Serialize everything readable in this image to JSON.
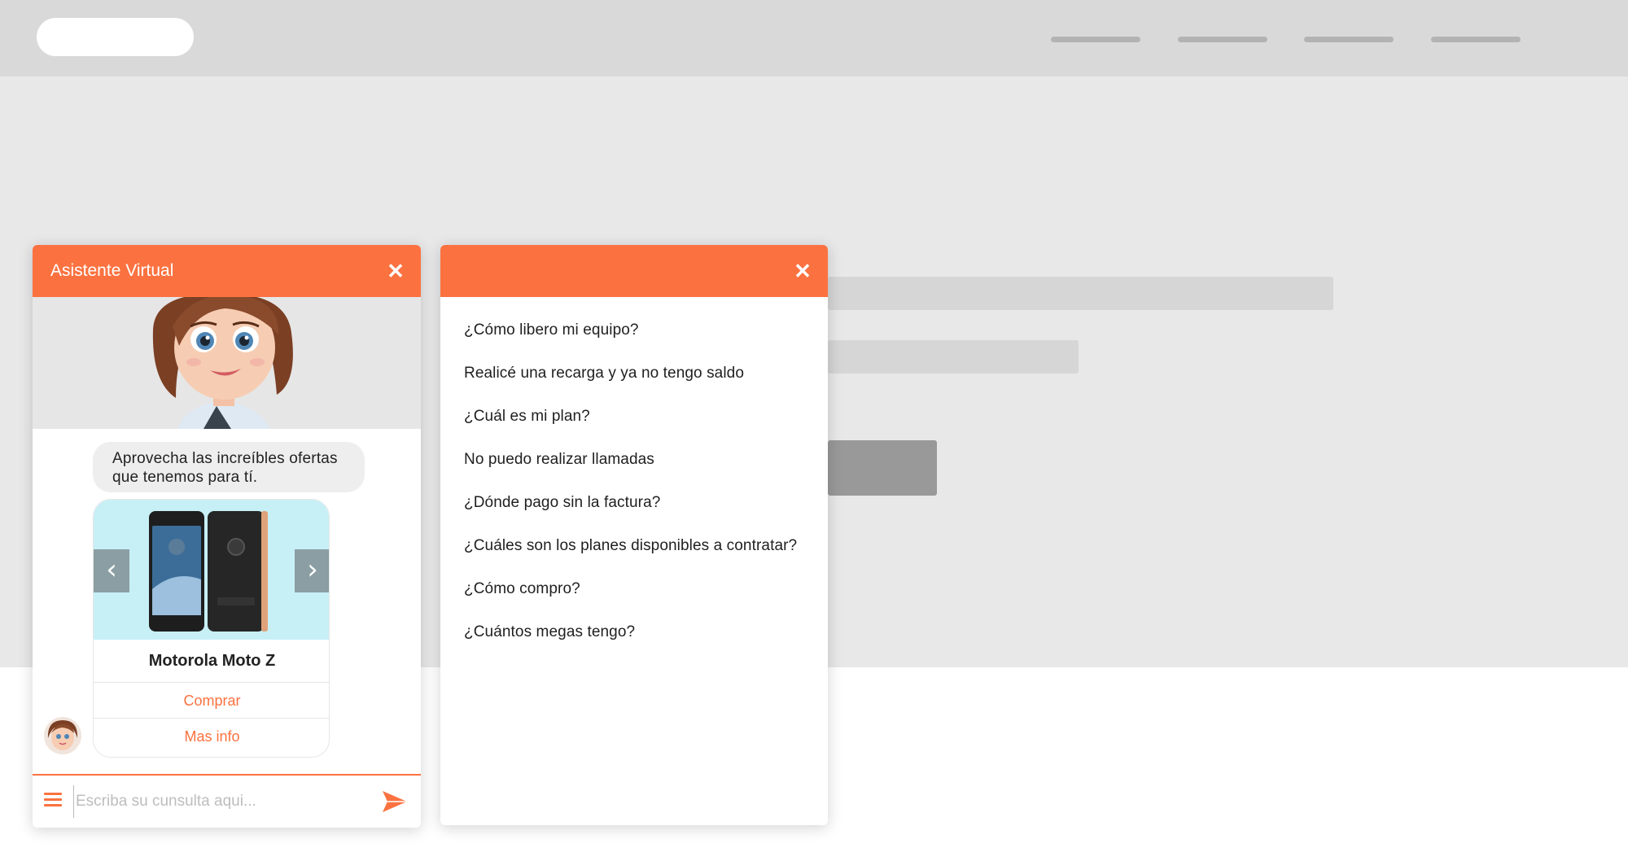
{
  "chat": {
    "title": "Asistente Virtual",
    "close_symbol": "✕",
    "greeting": "Aprovecha las increíbles ofertas que tenemos para tí.",
    "product": {
      "name": "Motorola Moto Z",
      "buy_label": "Comprar",
      "info_label": "Mas info",
      "prev_symbol": "‹",
      "next_symbol": "›"
    },
    "input": {
      "placeholder": "Escriba su cunsulta aqui...",
      "value": ""
    }
  },
  "faq": {
    "close_symbol": "✕",
    "items": [
      "¿Cómo libero mi equipo?",
      "Realicé una recarga y ya no tengo saldo",
      "¿Cuál es mi plan?",
      "No puedo realizar llamadas",
      "¿Dónde pago sin la factura?",
      "¿Cuáles son los planes disponibles a contratar?",
      "¿Cómo compro?",
      "¿Cuántos megas tengo?"
    ]
  },
  "colors": {
    "accent": "#fb7240",
    "header_bg": "#d9d9d9",
    "hero_bg": "#e8e8e8",
    "card_image_bg": "#c7f0f6"
  },
  "icons": {
    "close": "close-icon",
    "menu": "hamburger-menu-icon",
    "send": "send-icon",
    "prev": "chevron-left-icon",
    "next": "chevron-right-icon"
  }
}
